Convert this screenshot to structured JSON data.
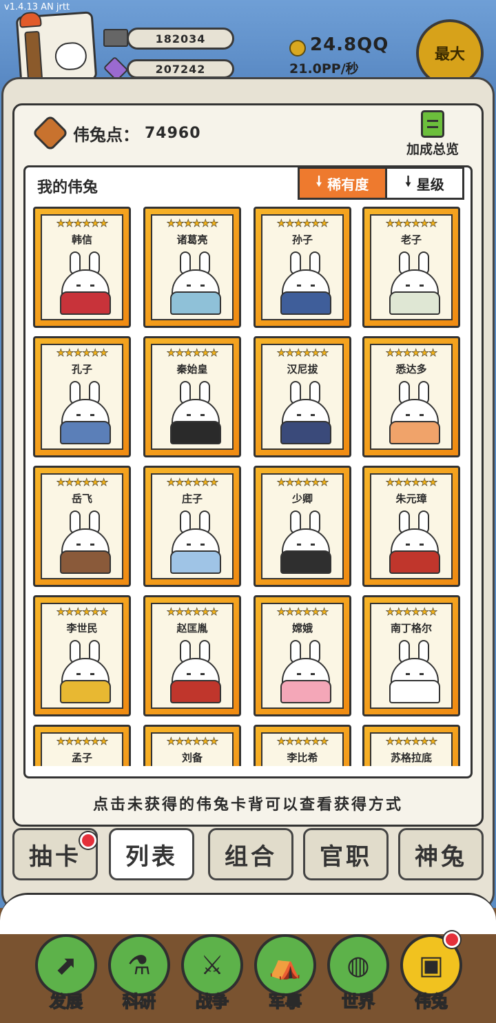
{
  "version": "v1.4.13 AN jrtt",
  "resources": {
    "stone": "182034",
    "crystal": "207242",
    "gold": "24.8QQ",
    "rate": "21.0PP/秒",
    "max_label": "最大"
  },
  "panel": {
    "points_label": "伟兔点：",
    "points_value": "74960",
    "bonus_label": "加成总览",
    "my_title": "我的伟兔",
    "sort_rarity": "稀有度",
    "sort_star": "星级",
    "hint": "点击未获得的伟兔卡背可以查看获得方式"
  },
  "stars": "★★★★★★",
  "cards": [
    {
      "name": "韩信",
      "robe": "#c8333a"
    },
    {
      "name": "诸葛亮",
      "robe": "#8fc1d8"
    },
    {
      "name": "孙子",
      "robe": "#3f5e9a"
    },
    {
      "name": "老子",
      "robe": "#dfe7d4"
    },
    {
      "name": "孔子",
      "robe": "#5b7fb8"
    },
    {
      "name": "秦始皇",
      "robe": "#2a2a2a"
    },
    {
      "name": "汉尼拔",
      "robe": "#3a4a7a"
    },
    {
      "name": "悉达多",
      "robe": "#f0a36a"
    },
    {
      "name": "岳飞",
      "robe": "#8a5a3a"
    },
    {
      "name": "庄子",
      "robe": "#9fc4e6"
    },
    {
      "name": "少卿",
      "robe": "#2f2f2f"
    },
    {
      "name": "朱元璋",
      "robe": "#c0362c"
    },
    {
      "name": "李世民",
      "robe": "#e8b832"
    },
    {
      "name": "赵匡胤",
      "robe": "#c0362c"
    },
    {
      "name": "嫦娥",
      "robe": "#f4a7b8"
    },
    {
      "name": "南丁格尔",
      "robe": "#ffffff"
    },
    {
      "name": "孟子",
      "robe": "#5b7fb8"
    },
    {
      "name": "刘备",
      "robe": "#e2a03a"
    },
    {
      "name": "李比希",
      "robe": "#ffffff"
    },
    {
      "name": "苏格拉底",
      "robe": "#ffffff"
    }
  ],
  "tabs": [
    "抽卡",
    "列表",
    "组合",
    "官职",
    "神兔"
  ],
  "nav": [
    {
      "label": "发展",
      "icon": "arrow-up-icon",
      "glyph": "⬈"
    },
    {
      "label": "科研",
      "icon": "flask-icon",
      "glyph": "⚗"
    },
    {
      "label": "战争",
      "icon": "crossed-swords-icon",
      "glyph": "⚔"
    },
    {
      "label": "军事",
      "icon": "military-bag-icon",
      "glyph": "⛺"
    },
    {
      "label": "世界",
      "icon": "globe-icon",
      "glyph": "◍"
    },
    {
      "label": "伟兔",
      "icon": "bunny-portrait-icon",
      "glyph": "▣"
    }
  ]
}
